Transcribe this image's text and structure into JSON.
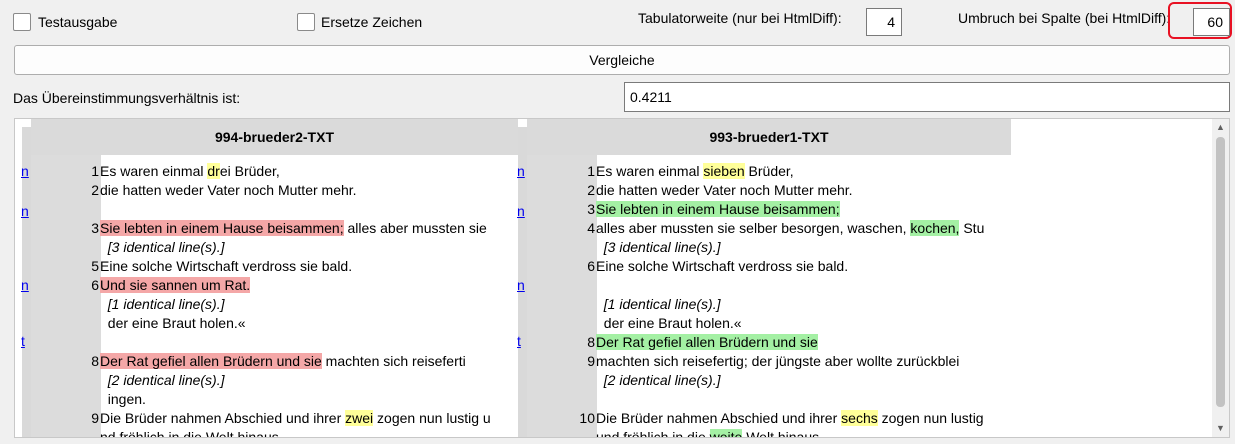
{
  "options": {
    "test_output": {
      "label": "Testausgabe",
      "checked": false
    },
    "replace_chars": {
      "label": "Ersetze Zeichen",
      "checked": false
    },
    "tab_width": {
      "label": "Tabulatorweite (nur bei HtmlDiff):",
      "value": "4"
    },
    "wrap_column": {
      "label": "Umbruch bei Spalte (bei HtmlDiff):",
      "value": "60"
    }
  },
  "compare_button": "Vergleiche",
  "ratio": {
    "label": "Das Übereinstimmungsverhältnis ist:",
    "value": "0.4211"
  },
  "diff": {
    "left_header": "994-brueder2-TXT",
    "right_header": "993-brueder1-TXT",
    "nav_links": [
      "n",
      "n",
      "n",
      "t"
    ],
    "left": {
      "n1": "1",
      "l1a": "Es waren einmal ",
      "l1b": "dr",
      "l1c": "ei Brüder,",
      "n2": "2",
      "l2": "die hatten weder Vater noch Mutter mehr.",
      "n3": "3",
      "l3a": "Sie lebten in einem Hause beisammen;",
      "l3b": " alles aber mussten sie",
      "ident3": "[3 identical line(s).]",
      "n5": "5",
      "l5": "Eine solche Wirtschaft verdross sie bald.",
      "n6": "6",
      "l6": "Und sie sannen um Rat.",
      "ident1": "[1 identical line(s).]",
      "braut": "der eine Braut holen.«",
      "n8": "8",
      "l8a": "Der Rat gefiel allen Brüdern und sie",
      "l8b": " machten sich reiseferti",
      "ident2": "[2 identical line(s).]",
      "ingen": "ingen.",
      "n9": "9",
      "l9a": "Die Brüder nahmen Abschied und ihrer ",
      "l9b": "zwei",
      "l9c": " zogen nun lustig u",
      "l9d": "nd fröhlich in die Welt hinaus."
    },
    "right": {
      "n1": "1",
      "l1a": "Es waren einmal ",
      "l1b": "sieben",
      "l1c": " Brüder,",
      "n2": "2",
      "l2": "die hatten weder Vater noch Mutter mehr.",
      "n3": "3",
      "l3": "Sie lebten in einem Hause beisammen;",
      "n4": "4",
      "l4a": "alles aber mussten sie selber besorgen, waschen, ",
      "l4b": "kochen,",
      "l4c": " Stu",
      "ident3": "[3 identical line(s).]",
      "n6": "6",
      "l6": "Eine solche Wirtschaft verdross sie bald.",
      "ident1": "[1 identical line(s).]",
      "braut": "der eine Braut holen.«",
      "n8": "8",
      "l8": "Der Rat gefiel allen Brüdern und sie",
      "n9": "9",
      "l9": "machten sich reisefertig; der jüngste aber wollte zurückblei",
      "ident2": "[2 identical line(s).]",
      "n10": "10",
      "l10a": "Die Brüder nahmen Abschied und ihrer ",
      "l10b": "sechs",
      "l10c": " zogen nun lustig",
      "l10d": "und fröhlich in die ",
      "l10e": "weite",
      "l10f": " Welt hinaus."
    }
  },
  "colors": {
    "added": "#a4f0a4",
    "removed": "#f4a7a7",
    "changed": "#ffff99",
    "focus_ring": "#e81123"
  }
}
